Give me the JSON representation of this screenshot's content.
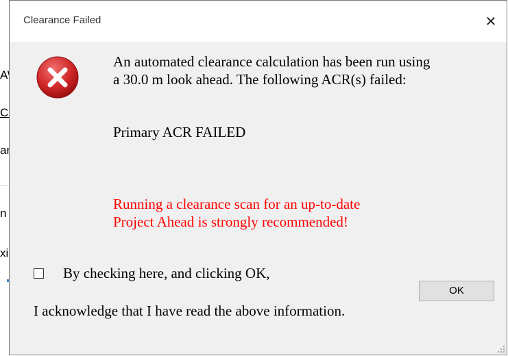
{
  "background_window": {
    "frag1": "AW",
    "frag2": "Co",
    "frag3": "ar",
    "frag4": "n I",
    "frag5": "xi"
  },
  "dialog": {
    "title": "Clearance Failed",
    "close_glyph": "✕",
    "icon": "error-icon",
    "message_line1": "An automated clearance calculation has been run using",
    "message_line2": "a 30.0 m look ahead.  The following ACR(s) failed:",
    "failed_item": "Primary ACR FAILED",
    "warning_line1": "Running a clearance scan for an up-to-date",
    "warning_line2": "Project Ahead is strongly recommended!",
    "checkbox_label": "By checking here, and clicking OK,",
    "checkbox_checked": false,
    "acknowledge_text": "I acknowledge that I have read the above information.",
    "ok_label": "OK"
  },
  "colors": {
    "warning_text": "#ff0000",
    "dialog_background": "#f0f0f0",
    "error_icon": "#d32a2a"
  }
}
